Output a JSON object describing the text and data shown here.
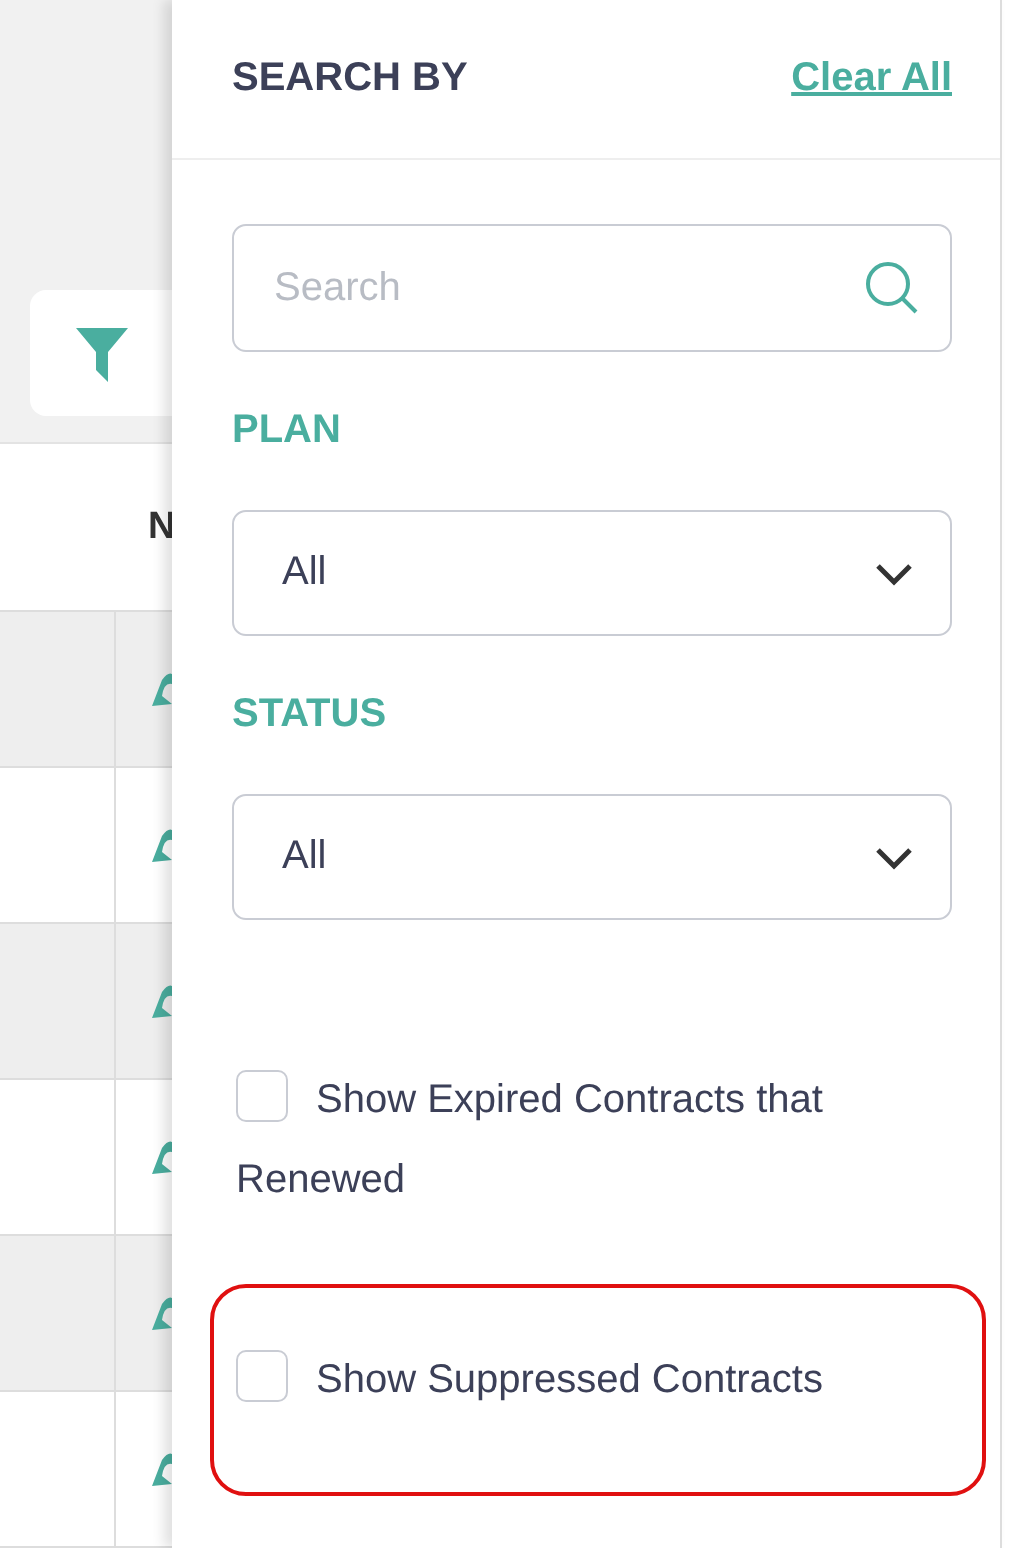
{
  "table": {
    "columns": [
      {
        "label": "N"
      }
    ],
    "rows": [
      {
        "kind": "icon_row"
      },
      {
        "kind": "icon_row"
      },
      {
        "kind": "icon_row"
      },
      {
        "kind": "icon_row"
      },
      {
        "kind": "icon_row"
      },
      {
        "kind": "icon_row"
      }
    ]
  },
  "panel": {
    "title": "SEARCH BY",
    "clear_link": "Clear All",
    "search": {
      "placeholder": "Search"
    },
    "filters": [
      {
        "label": "PLAN",
        "value": "All"
      },
      {
        "label": "STATUS",
        "value": "All"
      }
    ],
    "options": [
      {
        "label": "Show Expired Contracts that Renewed",
        "checked": false,
        "highlighted": false
      },
      {
        "label": "Show Suppressed Contracts",
        "checked": false,
        "highlighted": true
      }
    ]
  }
}
